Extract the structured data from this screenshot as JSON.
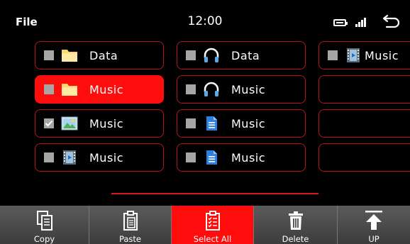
{
  "statusbar": {
    "title": "File",
    "time": "12:00"
  },
  "grid": {
    "columns": [
      [
        {
          "label": "Data",
          "icon": "folder-icon",
          "checked": false,
          "selected": false
        },
        {
          "label": "Music",
          "icon": "folder-icon",
          "checked": false,
          "selected": true
        },
        {
          "label": "Music",
          "icon": "image-file-icon",
          "checked": true,
          "selected": false
        },
        {
          "label": "Music",
          "icon": "video-file-icon",
          "checked": false,
          "selected": false
        }
      ],
      [
        {
          "label": "Data",
          "icon": "headphones-icon",
          "checked": false,
          "selected": false
        },
        {
          "label": "Music",
          "icon": "headphones-icon",
          "checked": false,
          "selected": false
        },
        {
          "label": "Music",
          "icon": "document-icon",
          "checked": false,
          "selected": false
        },
        {
          "label": "Music",
          "icon": "document-icon",
          "checked": false,
          "selected": false
        }
      ],
      [
        {
          "label": "Music",
          "icon": "video-file-icon",
          "checked": false,
          "selected": false
        }
      ]
    ]
  },
  "toolbar": {
    "copy_label": "Copy",
    "paste_label": "Paste",
    "select_all_label": "Select All",
    "delete_label": "Delete",
    "up_label": "UP"
  },
  "colors": {
    "accent": "#ff0d0d",
    "border": "#b3141d",
    "toolbar": "#4a4a4a"
  }
}
